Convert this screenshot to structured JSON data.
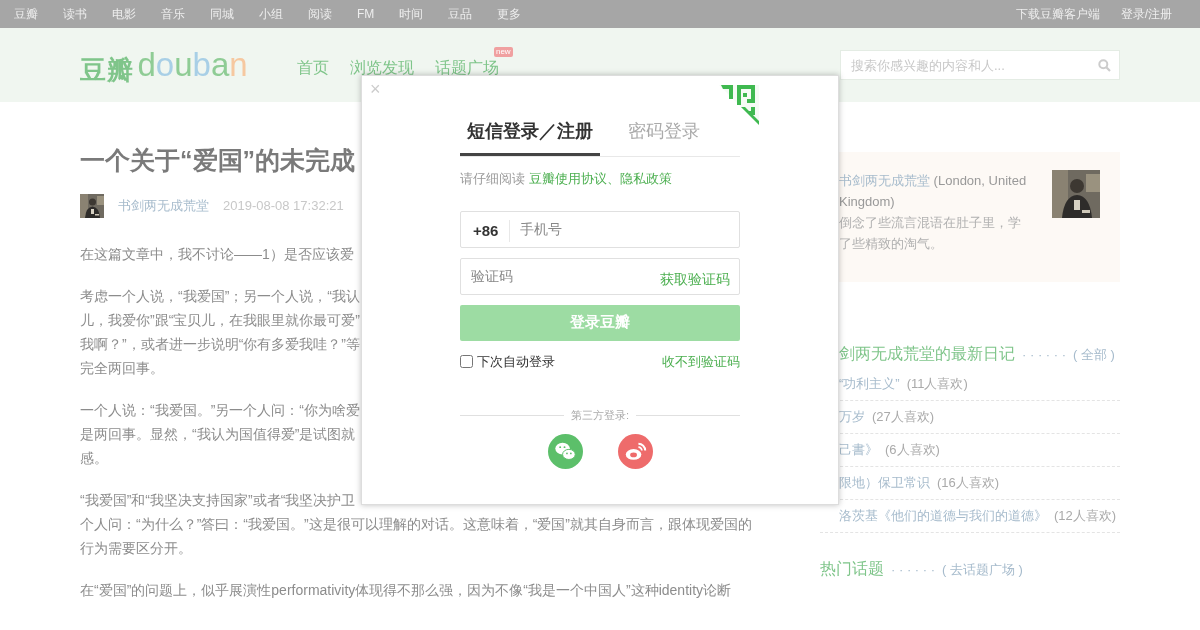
{
  "top_bar": {
    "left_links": [
      "豆瓣",
      "读书",
      "电影",
      "音乐",
      "同城",
      "小组",
      "阅读",
      "FM",
      "时间",
      "豆品",
      "更多"
    ],
    "right_links": [
      "下载豆瓣客户端",
      "登录/注册"
    ]
  },
  "header": {
    "logo": {
      "cn": "豆瓣",
      "en": "douban"
    },
    "nav": [
      {
        "label": "首页"
      },
      {
        "label": "浏览发现"
      },
      {
        "label": "话题广场",
        "badge": "new"
      }
    ],
    "search": {
      "placeholder": "搜索你感兴趣的内容和人..."
    }
  },
  "article": {
    "title": "一个关于“爱国”的未完成",
    "author": "书剑两无成荒堂",
    "date": "2019-08-08 17:32:21",
    "paragraphs": [
      [
        "在这篇文章中，我不讨论——1）是否应该爱"
      ],
      [
        "考虑一个人说，“我爱国”；另一个人说，“我认",
        "儿，我爱你”跟“宝贝儿，在我眼里就你最可爱”",
        "我啊？”，或者进一步说明“你有多爱我哇？”等",
        "完全两回事。"
      ],
      [
        "一个人说：“我爱国。”另一个人问：“你为啥爱",
        "是两回事。显然，“我认为国值得爱”是试图就",
        "感。"
      ],
      [
        "“我爱国”和“我坚决支持国家”或者“我坚决护卫",
        "个人问：“为什么？”答曰：“我爱国。”这是很可以理解的对话。这意味着，“爱国”就其自身而言，跟体现爱国的",
        "行为需要区分开。"
      ],
      [
        "在“爱国”的问题上，似乎展演性performativity体现得不那么强，因为不像“我是一个中国人”这种identity论断"
      ]
    ]
  },
  "sidebar": {
    "profile": {
      "name": "书剑两无成荒堂",
      "location": "(London, United Kingdom)",
      "bio_lines": [
        "倒念了些流言混语在肚子里，学",
        "了些精致的淘气。"
      ]
    },
    "diary": {
      "title": "剑两无成荒堂的最新日记",
      "dots": "· · · · · ·",
      "more": "( 全部 )",
      "items": [
        {
          "title": "“功利主义”",
          "likes": "(11人喜欢)"
        },
        {
          "title": "万岁",
          "likes": "(27人喜欢)"
        },
        {
          "title": "己書》",
          "likes": "(6人喜欢)"
        },
        {
          "title": "限地）保卫常识",
          "likes": "(16人喜欢)"
        },
        {
          "title": "洛茨基《他们的道德与我们的道德》",
          "likes": "(12人喜欢)"
        }
      ]
    },
    "topics": {
      "title": "热门话题",
      "dots": "· · · · · ·",
      "more": "( 去话题广场 )"
    }
  },
  "login_dialog": {
    "close": "×",
    "tabs": [
      {
        "label": "短信登录／注册",
        "selected": true
      },
      {
        "label": "密码登录",
        "selected": false
      }
    ],
    "agreement_prefix": "请仔细阅读",
    "agreement_link": "豆瓣使用协议、隐私政策",
    "phone": {
      "prefix": "+86",
      "placeholder": "手机号"
    },
    "code": {
      "placeholder": "验证码",
      "action": "获取验证码"
    },
    "submit": {
      "label": "登录豆瓣",
      "disabled": true
    },
    "remember": {
      "label": "下次自动登录",
      "checked": false
    },
    "help_link": "收不到验证码",
    "third_party_label": "第三方登录:"
  }
}
